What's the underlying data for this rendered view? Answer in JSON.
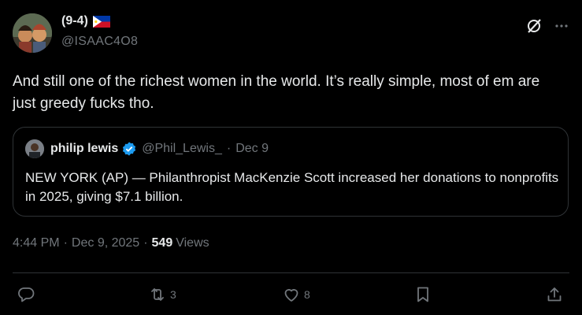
{
  "author": {
    "display_name": "(9-4)",
    "flag": "philippines-flag",
    "handle": "@ISAAC4O8"
  },
  "tweet": {
    "text": "And still one of the richest women in the world. It’s really simple, most of em are just greedy fucks tho."
  },
  "quoted": {
    "name": "philip lewis",
    "handle": "@Phil_Lewis_",
    "dot": "·",
    "date": "Dec 9",
    "text": "NEW YORK (AP) — Philanthropist MacKenzie Scott increased her donations to nonprofits in 2025, giving $7.1 billion."
  },
  "meta": {
    "time": "4:44 PM",
    "sep1": "·",
    "date": "Dec 9, 2025",
    "sep2": "·",
    "views": "549",
    "views_label": "Views"
  },
  "actions": {
    "reply_count": "",
    "repost_count": "3",
    "like_count": "8"
  },
  "colors": {
    "background": "#000000",
    "text": "#e7e9ea",
    "secondary": "#71767b",
    "border": "#2f3336",
    "verified": "#1d9bf0"
  }
}
